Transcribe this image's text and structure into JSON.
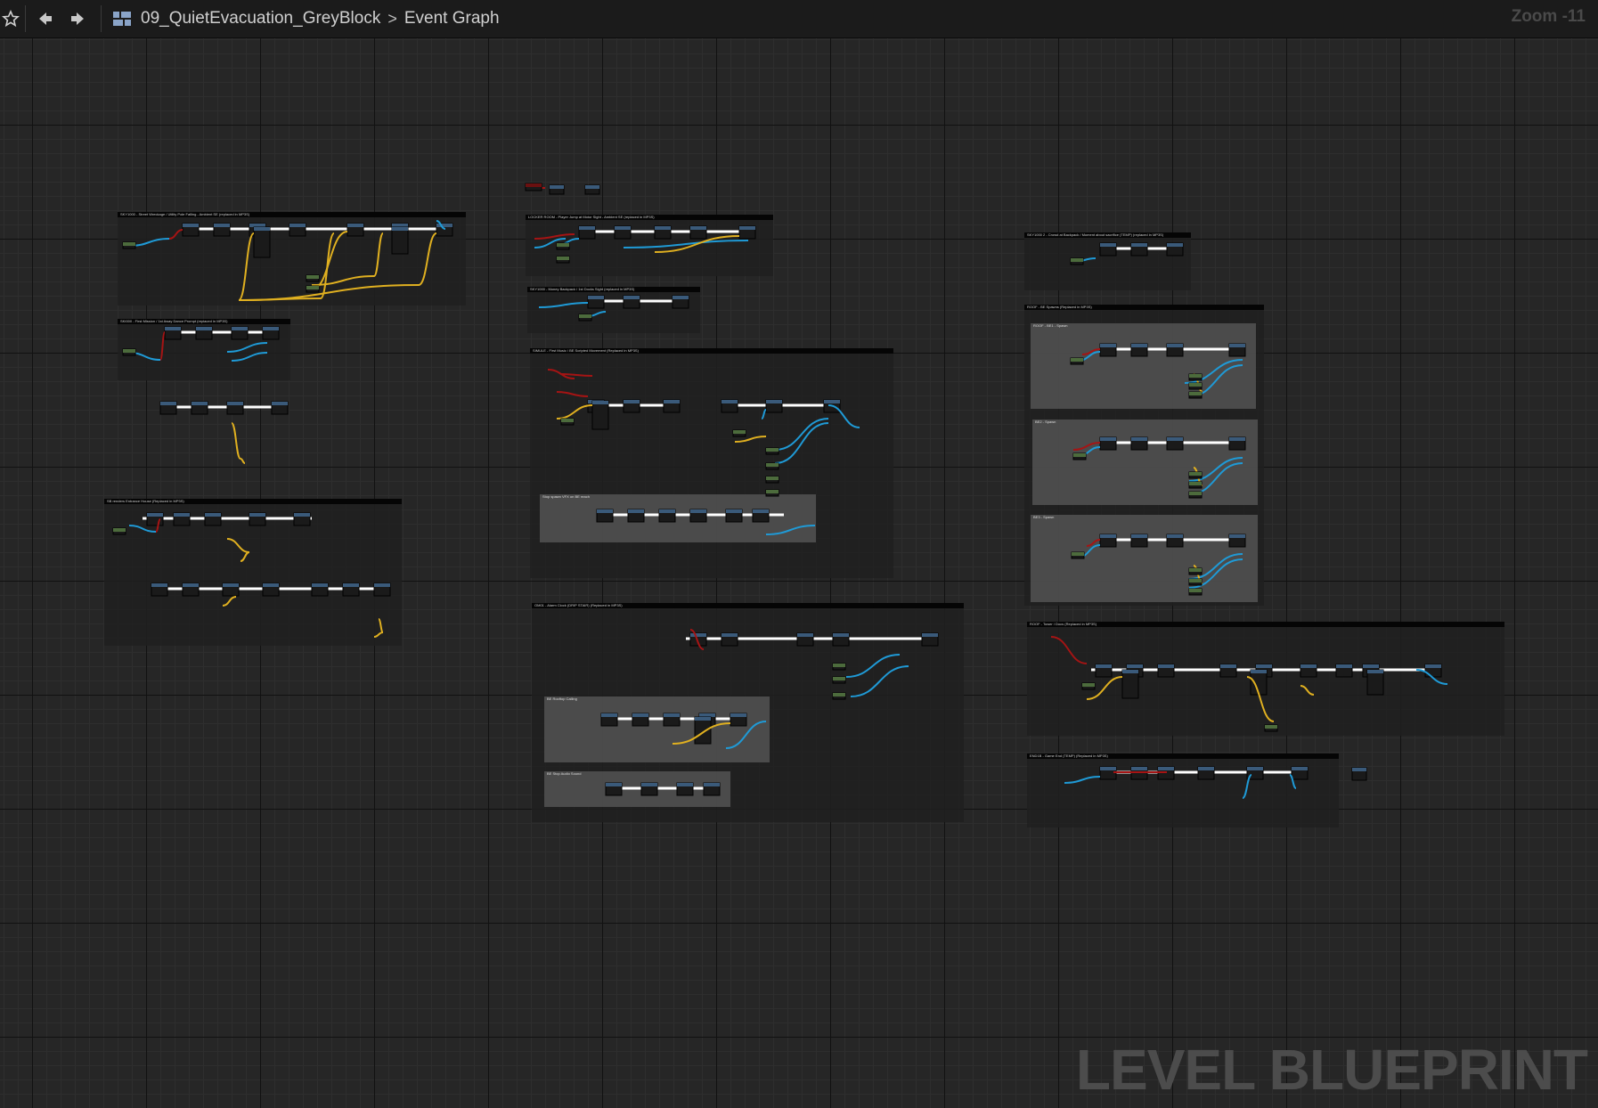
{
  "toolbar": {
    "favorite_icon": "star-icon",
    "back_icon": "arrow-left-icon",
    "forward_icon": "arrow-right-icon",
    "graph_icon": "blueprint-graph-icon",
    "breadcrumb_level": "09_QuietEvacuation_GreyBlock",
    "breadcrumb_separator": ">",
    "breadcrumb_graph": "Event Graph"
  },
  "zoom_label": "Zoom -11",
  "watermark": "LEVEL BLUEPRINT",
  "colors": {
    "exec_wire": "#ffffff",
    "object_wire": "#1f9ad6",
    "bool_wire": "#a51414",
    "float_wire": "#e0b020",
    "node_header": "#3a5a7a",
    "node_green": "#4c6b3c"
  },
  "comments": {
    "c1": "SKY1000 - Street Wreckage / Utility Pole Falling - Ambient SE (replaced in MP3S)",
    "c2": "SKI000 - First Mission / 1st Away Dance Prompt (replaced in MP3S)",
    "c3": "SB renders Entrance House (Replaced in MP3S)",
    "c4": "LOCKER ROOM - Player Jump at Motor Sight - Ambient SE (replaced in MP3S)",
    "c5": "SKY1000 - Money Backpack / 1st Docks Sight (replaced in MP3S)",
    "c6": "SIMULE - First Music / BE Scripted Movement (Replaced in MP3S)",
    "c6sub": "Stop spawn VFX on BE reach",
    "c7": "OM01 - Alarm Clock (DRIP STAIR) (Replaced in MP3S)",
    "c7sub1": "BE Rooftop Calling",
    "c7sub2": "BE Stop Audio Sound",
    "c8": "SKY1000 2 - Crowd at Backpack / Moment about sacrifice (TEMP) (replaced in MP3S)",
    "c9": "ROOF - BE Spawns (Replaced in MP3S)",
    "c9sub1": "ROOF - BE1 - Spawn",
    "c9sub2": "BE2 - Spawn",
    "c9sub3": "BE3 - Spawn",
    "c10": "ROOF - Tower / Docs (Replaced in MP3S)",
    "c11": "END1B - Game End (TEMP) (Replaced in MP3S)"
  }
}
